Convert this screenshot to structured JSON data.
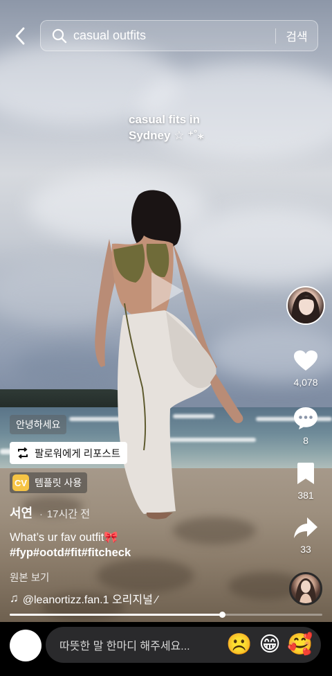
{
  "search": {
    "query": "casual outfits",
    "submit_label": "검색"
  },
  "video": {
    "caption_line1": "casual fits in",
    "caption_line2": "Sydney ☆ ⁺˚⁎"
  },
  "actions": {
    "likes": "4,078",
    "comments": "8",
    "bookmarks": "381",
    "shares": "33"
  },
  "chips": {
    "greeting": "안녕하세요",
    "repost": "팔로워에게 리포스트",
    "template": "템플릿 사용"
  },
  "post": {
    "author": "서연",
    "separator": "·",
    "time": "17시간 전",
    "description": "What’s ur fav outfit🎀",
    "hashtags": "#fyp#ootd#fit#fitcheck",
    "see_original": "원본 보기",
    "music": "@leanortizz.fan.1 오리지널 ⁄"
  },
  "playback": {
    "progress": 0.68
  },
  "comment_bar": {
    "placeholder": "따뜻한 말 한마디 해주세요...",
    "emojis": [
      "☹️",
      "😁",
      "🥰"
    ]
  },
  "colors": {
    "template_icon": "#f6c445",
    "comment_bg": "#2a2a2c"
  }
}
